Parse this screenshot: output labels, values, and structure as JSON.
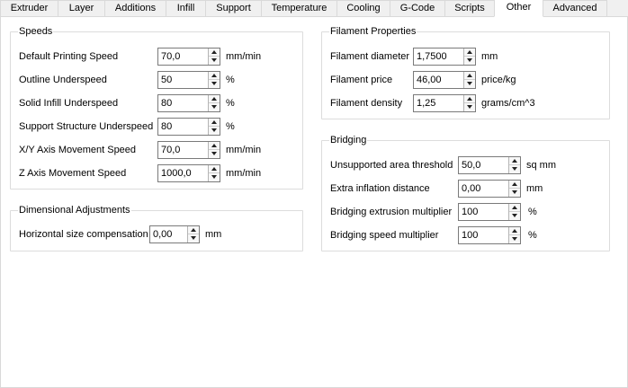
{
  "tabs": [
    "Extruder",
    "Layer",
    "Additions",
    "Infill",
    "Support",
    "Temperature",
    "Cooling",
    "G-Code",
    "Scripts",
    "Other",
    "Advanced"
  ],
  "active_tab": "Other",
  "speeds": {
    "title": "Speeds",
    "rows": [
      {
        "label": "Default Printing Speed",
        "value": "70,0",
        "unit": "mm/min"
      },
      {
        "label": "Outline Underspeed",
        "value": "50",
        "unit": "%"
      },
      {
        "label": "Solid Infill Underspeed",
        "value": "80",
        "unit": "%"
      },
      {
        "label": "Support Structure Underspeed",
        "value": "80",
        "unit": "%"
      },
      {
        "label": "X/Y Axis Movement Speed",
        "value": "70,0",
        "unit": "mm/min"
      },
      {
        "label": "Z Axis Movement Speed",
        "value": "1000,0",
        "unit": "mm/min"
      }
    ]
  },
  "dimensional": {
    "title": "Dimensional Adjustments",
    "rows": [
      {
        "label": "Horizontal size compensation",
        "value": "0,00",
        "unit": "mm"
      }
    ]
  },
  "filament": {
    "title": "Filament Properties",
    "rows": [
      {
        "label": "Filament diameter",
        "value": "1,7500",
        "unit": "mm"
      },
      {
        "label": "Filament price",
        "value": "46,00",
        "unit": "price/kg"
      },
      {
        "label": "Filament density",
        "value": "1,25",
        "unit": "grams/cm^3"
      }
    ]
  },
  "bridging": {
    "title": "Bridging",
    "rows": [
      {
        "label": "Unsupported area threshold",
        "value": "50,0",
        "unit": "sq mm"
      },
      {
        "label": "Extra inflation distance",
        "value": "0,00",
        "unit": "mm"
      },
      {
        "label": "Bridging extrusion multiplier",
        "value": "100",
        "unit": "%"
      },
      {
        "label": "Bridging speed multiplier",
        "value": "100",
        "unit": "%"
      }
    ]
  },
  "colors": {
    "background": "#f0f0f0",
    "panel": "#ffffff",
    "border": "#dcdcdc",
    "input_border": "#7a7a7a"
  }
}
